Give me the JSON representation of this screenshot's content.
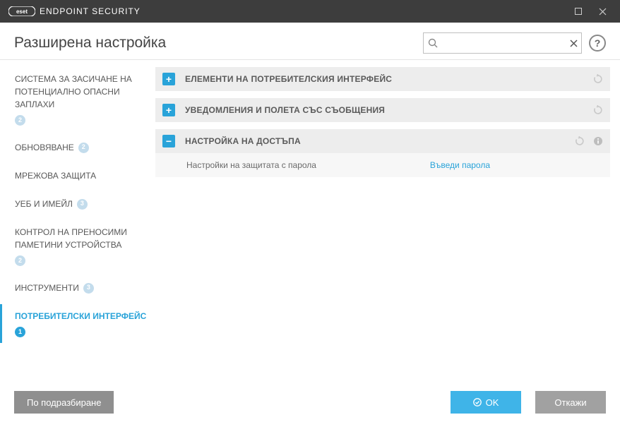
{
  "window": {
    "title": "ENDPOINT SECURITY",
    "brand": "eset"
  },
  "header": {
    "page_title": "Разширена настройка",
    "search_placeholder": "",
    "search_value": ""
  },
  "sidebar": {
    "items": [
      {
        "label": "СИСТЕМА ЗА ЗАСИЧАНЕ НА ПОТЕНЦИАЛНО ОПАСНИ ЗАПЛАХИ",
        "badge": "2",
        "active": false
      },
      {
        "label": "ОБНОВЯВАНЕ",
        "badge": "2",
        "active": false
      },
      {
        "label": "МРЕЖОВА ЗАЩИТА",
        "badge": null,
        "active": false
      },
      {
        "label": "УЕБ И ИМЕЙЛ",
        "badge": "3",
        "active": false
      },
      {
        "label": "КОНТРОЛ НА ПРЕНОСИМИ ПАМЕТИНИ УСТРОЙСТВА",
        "badge": "2",
        "active": false
      },
      {
        "label": "ИНСТРУМЕНТИ",
        "badge": "3",
        "active": false
      },
      {
        "label": "ПОТРЕБИТЕЛСКИ ИНТЕРФЕЙС",
        "badge": "1",
        "active": true
      }
    ]
  },
  "content": {
    "sections": [
      {
        "title": "ЕЛЕМЕНТИ НА ПОТРЕБИТЕЛСКИЯ ИНТЕРФЕЙС",
        "expanded": false,
        "has_reset": true,
        "has_info": false
      },
      {
        "title": "УВЕДОМЛЕНИЯ И ПОЛЕТА СЪС СЪОБЩЕНИЯ",
        "expanded": false,
        "has_reset": true,
        "has_info": false
      },
      {
        "title": "НАСТРОЙКА НА ДОСТЪПА",
        "expanded": true,
        "has_reset": true,
        "has_info": true,
        "rows": [
          {
            "label": "Настройки на защитата с парола",
            "action": "Въведи парола"
          }
        ]
      }
    ]
  },
  "footer": {
    "default_btn": "По подразбиране",
    "ok_btn": "OK",
    "cancel_btn": "Откажи"
  }
}
